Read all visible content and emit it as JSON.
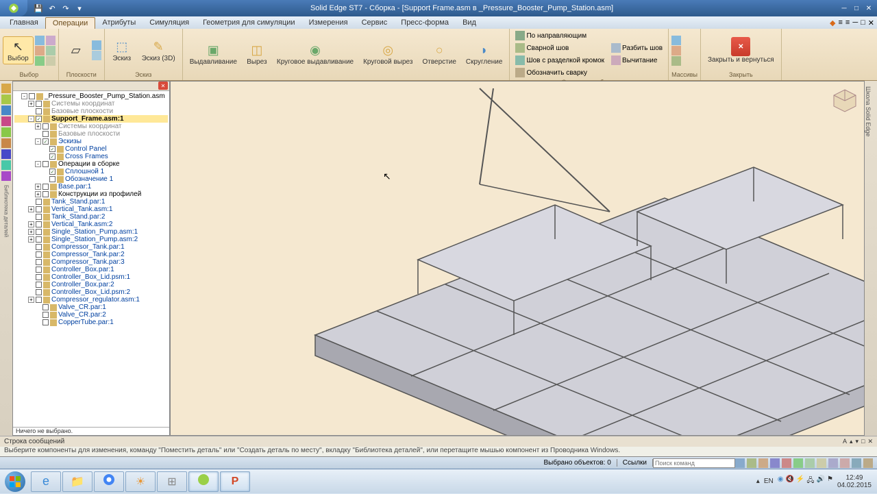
{
  "title": "Solid Edge ST7 - Сборка - [Support Frame.asm в _Pressure_Booster_Pump_Station.asm]",
  "menu": {
    "tabs": [
      "Главная",
      "Операции",
      "Атрибуты",
      "Симуляция",
      "Геометрия для симуляции",
      "Измерения",
      "Сервис",
      "Пресс-форма",
      "Вид"
    ],
    "active": 1
  },
  "ribbon": {
    "groups": [
      {
        "label": "Выбор",
        "items": [
          {
            "label": "Выбор"
          }
        ]
      },
      {
        "label": "Плоскости",
        "items": []
      },
      {
        "label": "Эскиз",
        "items": [
          {
            "label": "Эскиз"
          },
          {
            "label": "Эскиз (3D)"
          }
        ]
      },
      {
        "label": "",
        "items": [
          {
            "label": "Выдавливание"
          },
          {
            "label": "Вырез"
          },
          {
            "label": "Круговое выдавливание"
          },
          {
            "label": "Круговой вырез"
          },
          {
            "label": "Отверстие"
          },
          {
            "label": "Скругление"
          }
        ]
      },
      {
        "label": "Операции в сборке",
        "items": [
          {
            "label": "По направляющим"
          },
          {
            "label": "Сварной шов"
          },
          {
            "label": "Шов с разделкой кромок"
          },
          {
            "label": "Обозначить сварку"
          },
          {
            "label": "Разбить шов"
          },
          {
            "label": "Вычитание"
          }
        ]
      },
      {
        "label": "Массивы",
        "items": []
      },
      {
        "label": "Закрыть",
        "items": [
          {
            "label": "Закрыть и вернуться"
          }
        ]
      }
    ]
  },
  "tree": {
    "root": "_Pressure_Booster_Pump_Station.asm",
    "items": [
      {
        "ind": 1,
        "exp": "-",
        "chk": "",
        "label": "_Pressure_Booster_Pump_Station.asm",
        "cls": "black"
      },
      {
        "ind": 2,
        "exp": "+",
        "chk": "",
        "label": "Системы координат",
        "cls": "gray"
      },
      {
        "ind": 2,
        "exp": "",
        "chk": "",
        "label": "Базовые плоскости",
        "cls": "gray"
      },
      {
        "ind": 2,
        "exp": "-",
        "chk": "✓",
        "label": "Support_Frame.asm:1",
        "cls": "black",
        "sel": true,
        "bold": true
      },
      {
        "ind": 3,
        "exp": "+",
        "chk": "",
        "label": "Системы координат",
        "cls": "gray"
      },
      {
        "ind": 3,
        "exp": "",
        "chk": "",
        "label": "Базовые плоскости",
        "cls": "gray"
      },
      {
        "ind": 3,
        "exp": "-",
        "chk": "✓",
        "label": "Эскизы"
      },
      {
        "ind": 4,
        "exp": "",
        "chk": "✓",
        "label": "Control Panel"
      },
      {
        "ind": 4,
        "exp": "",
        "chk": "✓",
        "label": "Cross Frames"
      },
      {
        "ind": 3,
        "exp": "-",
        "chk": "",
        "label": "Операции в сборке",
        "cls": "black"
      },
      {
        "ind": 4,
        "exp": "",
        "chk": "✓",
        "label": "Сплошной 1"
      },
      {
        "ind": 4,
        "exp": "",
        "chk": "",
        "label": "Обозначение 1"
      },
      {
        "ind": 3,
        "exp": "+",
        "chk": "",
        "label": "Base.par:1"
      },
      {
        "ind": 3,
        "exp": "+",
        "chk": "",
        "label": "Конструкции из профилей",
        "cls": "black"
      },
      {
        "ind": 2,
        "exp": "",
        "chk": "",
        "label": "Tank_Stand.par:1"
      },
      {
        "ind": 2,
        "exp": "+",
        "chk": "",
        "label": "Vertical_Tank.asm:1"
      },
      {
        "ind": 2,
        "exp": "",
        "chk": "",
        "label": "Tank_Stand.par:2"
      },
      {
        "ind": 2,
        "exp": "+",
        "chk": "",
        "label": "Vertical_Tank.asm:2"
      },
      {
        "ind": 2,
        "exp": "+",
        "chk": "",
        "label": "Single_Station_Pump.asm:1"
      },
      {
        "ind": 2,
        "exp": "+",
        "chk": "",
        "label": "Single_Station_Pump.asm:2"
      },
      {
        "ind": 2,
        "exp": "",
        "chk": "",
        "label": "Compressor_Tank.par:1"
      },
      {
        "ind": 2,
        "exp": "",
        "chk": "",
        "label": "Compressor_Tank.par:2"
      },
      {
        "ind": 2,
        "exp": "",
        "chk": "",
        "label": "Compressor_Tank.par:3"
      },
      {
        "ind": 2,
        "exp": "",
        "chk": "",
        "label": "Controller_Box.par:1"
      },
      {
        "ind": 2,
        "exp": "",
        "chk": "",
        "label": "Controller_Box_Lid.psm:1"
      },
      {
        "ind": 2,
        "exp": "",
        "chk": "",
        "label": "Controller_Box.par:2"
      },
      {
        "ind": 2,
        "exp": "",
        "chk": "",
        "label": "Controller_Box_Lid.psm:2"
      },
      {
        "ind": 2,
        "exp": "+",
        "chk": "",
        "label": "Compressor_regulator.asm:1"
      },
      {
        "ind": 3,
        "exp": "",
        "chk": "",
        "label": "Valve_CR.par:1"
      },
      {
        "ind": 3,
        "exp": "",
        "chk": "",
        "label": "Valve_CR.par:2"
      },
      {
        "ind": 3,
        "exp": "",
        "chk": "",
        "label": "CopperTube.par:1"
      }
    ],
    "footer": "Ничего не выбрано."
  },
  "msgbar": {
    "title": "Строка сообщений"
  },
  "hint": "Выберите компоненты для изменения, команду \"Поместить деталь\" или \"Создать деталь по месту\", вкладку \"Библиотека деталей\", или перетащите мышью компонент из Проводника Windows.",
  "status": {
    "selected": "Выбрано объектов: 0",
    "search": "Поиск команд",
    "links": "Ссылки"
  },
  "tray": {
    "lang": "EN",
    "time": "12:49",
    "date": "04.02.2015"
  },
  "rightbar": "Школа Solid Edge"
}
